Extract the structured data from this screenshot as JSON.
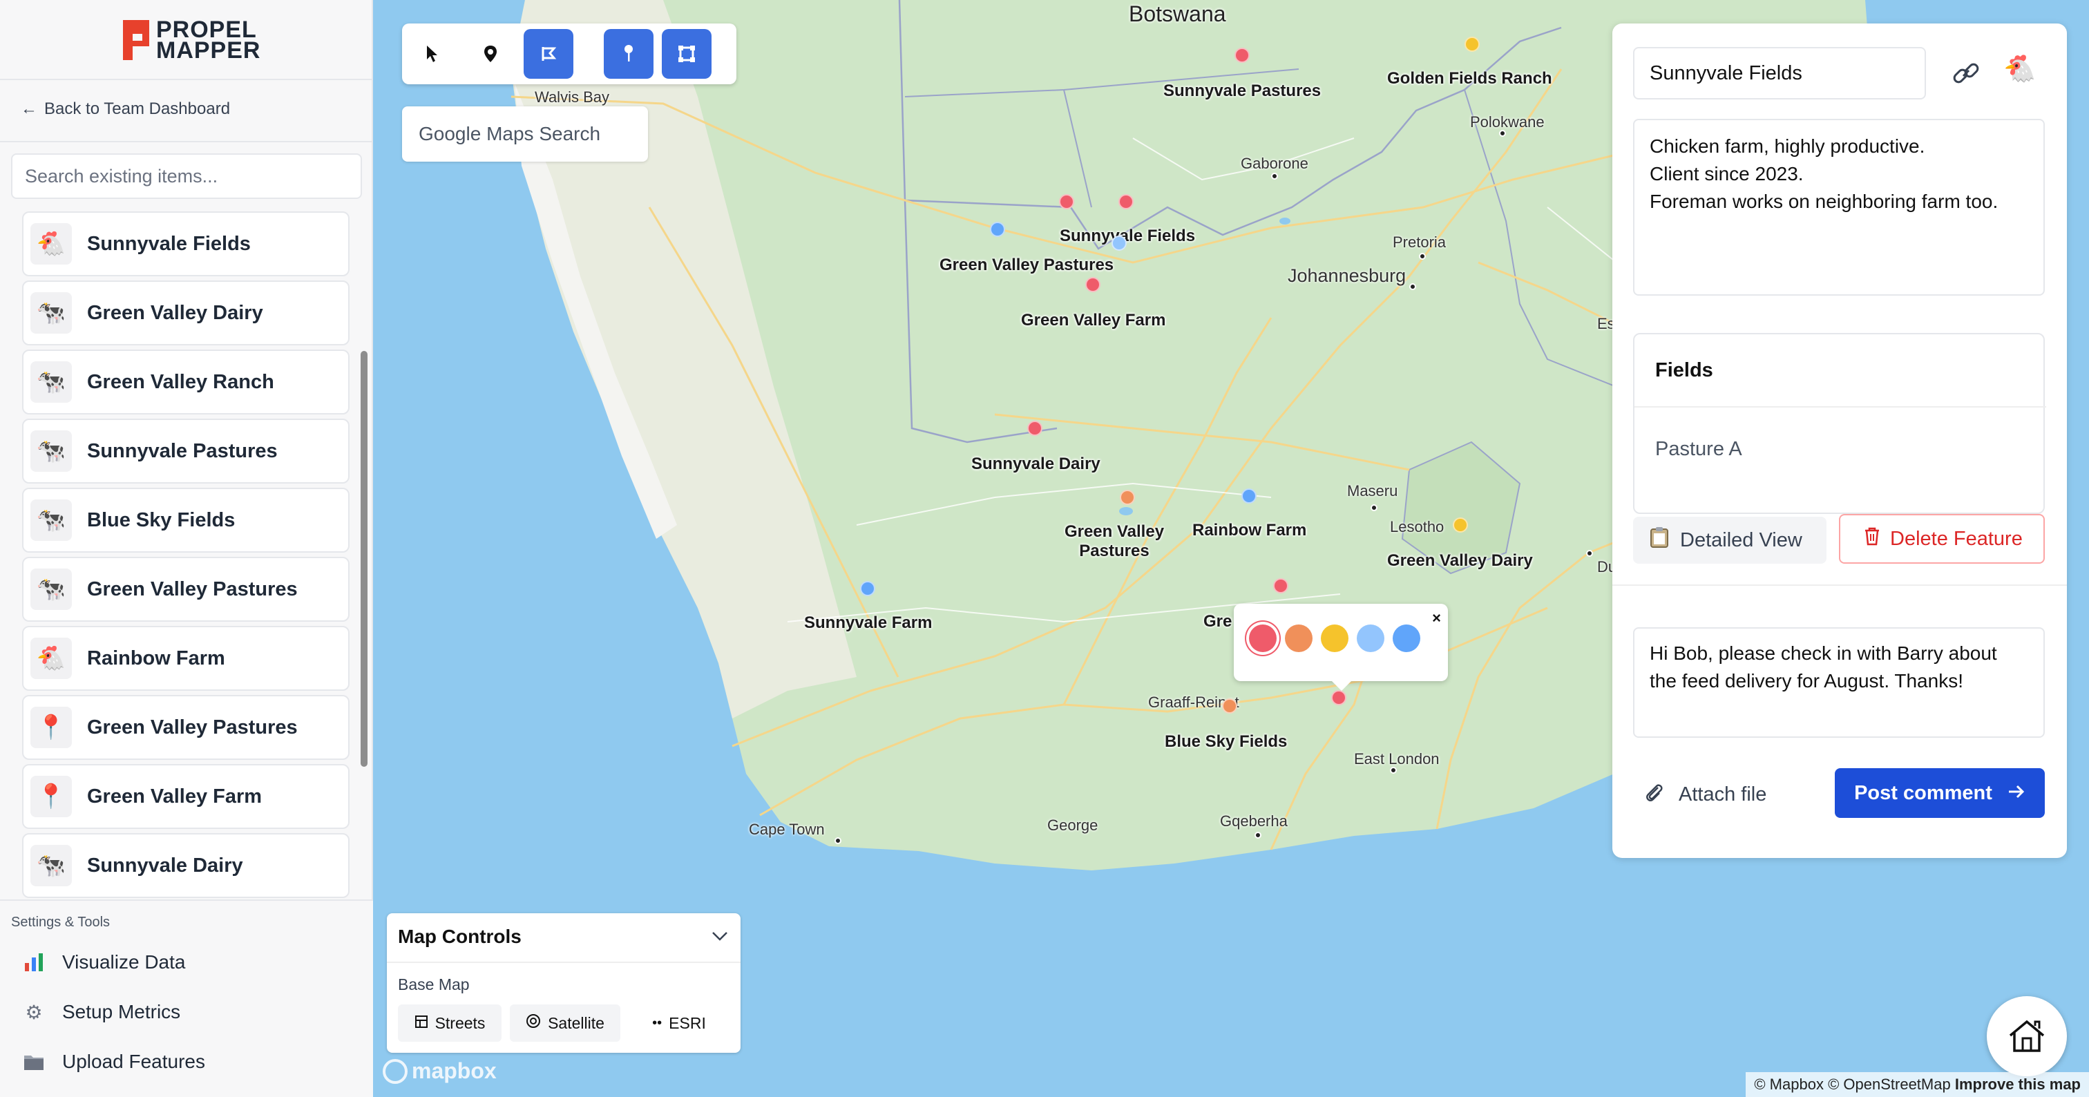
{
  "app": {
    "logo_line1": "PROPEL",
    "logo_line2": "MAPPER"
  },
  "sidebar": {
    "back_label": "Back to Team Dashboard",
    "search_placeholder": "Search existing items...",
    "items": [
      {
        "label": "Sunnyvale Fields",
        "icon": "chicken-icon"
      },
      {
        "label": "Green Valley Dairy",
        "icon": "cow-icon"
      },
      {
        "label": "Green Valley Ranch",
        "icon": "cow-icon"
      },
      {
        "label": "Sunnyvale Pastures",
        "icon": "cow-icon"
      },
      {
        "label": "Blue Sky Fields",
        "icon": "cow-icon"
      },
      {
        "label": "Green Valley Pastures",
        "icon": "cow-icon"
      },
      {
        "label": "Rainbow Farm",
        "icon": "chicken-icon"
      },
      {
        "label": "Green Valley Pastures",
        "icon": "pin-icon"
      },
      {
        "label": "Green Valley Farm",
        "icon": "pin-icon"
      },
      {
        "label": "Sunnyvale Dairy",
        "icon": "cow-icon"
      }
    ],
    "settings": {
      "heading": "Settings & Tools",
      "items": [
        {
          "label": "Visualize Data",
          "icon": "chart-icon"
        },
        {
          "label": "Setup Metrics",
          "icon": "gear-icon"
        },
        {
          "label": "Upload Features",
          "icon": "folder-icon"
        }
      ]
    }
  },
  "map": {
    "google_search_placeholder": "Google Maps Search",
    "country_labels": [
      "Botswana"
    ],
    "town_labels": [
      "Walvis Bay",
      "Gaborone",
      "Polokwane",
      "Pretoria",
      "Johannesburg",
      "Maseru",
      "Lesotho",
      "Graaff-Reinet",
      "East London",
      "Gqeberha",
      "George",
      "Cape Town",
      "Es",
      "Du"
    ],
    "feature_labels": [
      "Sunnyvale Pastures",
      "Golden Fields Ranch",
      "Sunnyvale Fields",
      "Green Valley Pastures",
      "Green Valley Farm",
      "Sunnyvale Dairy",
      "Green Valley Pastures",
      "Rainbow Farm",
      "Green Valley Dairy",
      "Sunnyvale Farm",
      "Blue Sky Fields",
      "Gre"
    ],
    "marker_colors": {
      "red": "#ef5b6a",
      "orange": "#f0905a",
      "yellow": "#f5c32c",
      "lightblue": "#93c5fd",
      "blue": "#60a5fa"
    },
    "color_picker": {
      "close": "×",
      "swatches": [
        "#ef5b6a",
        "#f0905a",
        "#f5c32c",
        "#93c5fd",
        "#60a5fa"
      ],
      "selected": 0
    },
    "controls": {
      "title": "Map Controls",
      "base_map_label": "Base Map",
      "options": [
        "Streets",
        "Satellite",
        "ESRI"
      ]
    },
    "mapbox_logo": "mapbox",
    "attribution": {
      "mapbox": "© Mapbox",
      "osm": "© OpenStreetMap",
      "improve": "Improve this map"
    }
  },
  "panel": {
    "feature_name": "Sunnyvale Fields",
    "description": "Chicken farm, highly productive.\nClient since 2023.\nForeman works on neighboring farm too.",
    "fields_heading": "Fields",
    "fields_value": "Pasture A",
    "detailed_view": "Detailed View",
    "delete_feature": "Delete Feature",
    "comment": "Hi Bob, please check in with Barry about the feed delivery for August. Thanks!",
    "attach_file": "Attach file",
    "post_comment": "Post comment"
  }
}
